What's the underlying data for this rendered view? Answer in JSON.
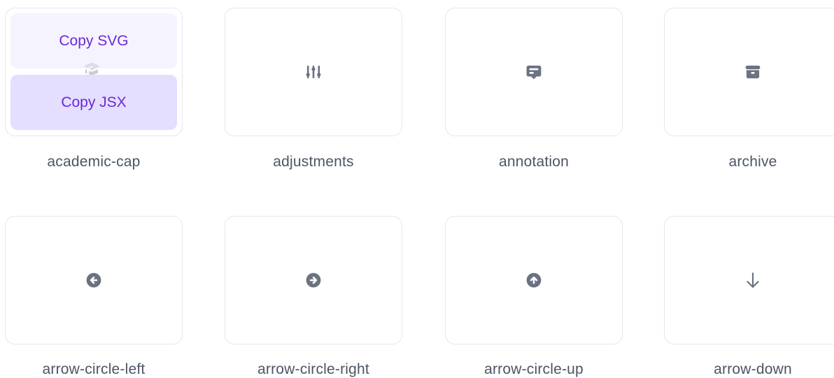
{
  "colors": {
    "icon": "#6b7280",
    "caption": "#4b5563",
    "border": "#e5e7eb",
    "accent_text": "#6d28d9",
    "copy_jsx_bg": "#e4deff",
    "copy_svg_bg": "#f3f0ff"
  },
  "hover_overlay": {
    "copy_svg_label": "Copy SVG",
    "copy_jsx_label": "Copy JSX"
  },
  "icons": [
    {
      "name": "academic-cap",
      "icon": "academic-cap-icon"
    },
    {
      "name": "adjustments",
      "icon": "adjustments-icon"
    },
    {
      "name": "annotation",
      "icon": "annotation-icon"
    },
    {
      "name": "archive",
      "icon": "archive-icon"
    },
    {
      "name": "arrow-circle-left",
      "icon": "arrow-circle-left-icon"
    },
    {
      "name": "arrow-circle-right",
      "icon": "arrow-circle-right-icon"
    },
    {
      "name": "arrow-circle-up",
      "icon": "arrow-circle-up-icon"
    },
    {
      "name": "arrow-down",
      "icon": "arrow-down-icon"
    }
  ]
}
